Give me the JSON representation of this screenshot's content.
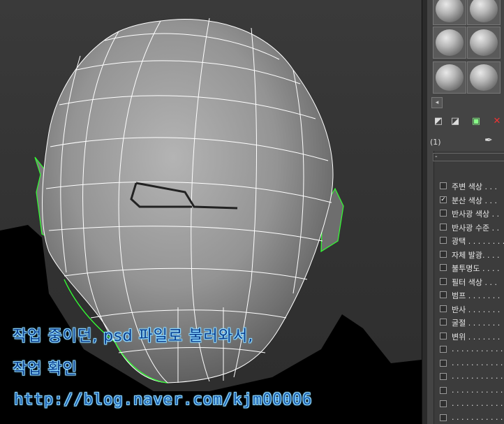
{
  "overlay": {
    "caption_line1": "작업 중이던, psd 파일로 불러와서,",
    "caption_line2": "작업 확인",
    "blog_url": "http://blog.naver.com/kjm00006"
  },
  "material_editor": {
    "scroll_arrow": "◂",
    "toolbar_icons": [
      "assign-material-icon",
      "put-to-library-icon",
      "reset-map-icon",
      "delete-icon"
    ],
    "slot_name": "(1)",
    "rollout_title": "-",
    "maps": [
      {
        "label": "주변 색상 . . .",
        "checked": false
      },
      {
        "label": "분산 색상 . . .",
        "checked": true
      },
      {
        "label": "반사광 색상 . .",
        "checked": false
      },
      {
        "label": "반사광 수준 . .",
        "checked": false
      },
      {
        "label": "광택 . . . . . . . .",
        "checked": false
      },
      {
        "label": "자체 발광. . . .",
        "checked": false
      },
      {
        "label": "불투명도 . . . .",
        "checked": false
      },
      {
        "label": "필터 색상 . . .",
        "checked": false
      },
      {
        "label": "범프 . . . . . . .",
        "checked": false
      },
      {
        "label": "반사 . . . . . . .",
        "checked": false
      },
      {
        "label": "굴절 . . . . . . .",
        "checked": false
      },
      {
        "label": "변위 . . . . . . .",
        "checked": false
      },
      {
        "label": ". . . . . . . . . . .",
        "checked": false
      },
      {
        "label": ". . . . . . . . . . .",
        "checked": false
      },
      {
        "label": ". . . . . . . . . . .",
        "checked": false
      },
      {
        "label": ". . . . . . . . . . .",
        "checked": false
      },
      {
        "label": ". . . . . . . . . . .",
        "checked": false
      },
      {
        "label": ". . . . . . . . . . .",
        "checked": false
      }
    ],
    "colors": {
      "panel_bg": "#444444",
      "wire_white": "#ffffff",
      "wire_selected": "#33ff33"
    }
  }
}
